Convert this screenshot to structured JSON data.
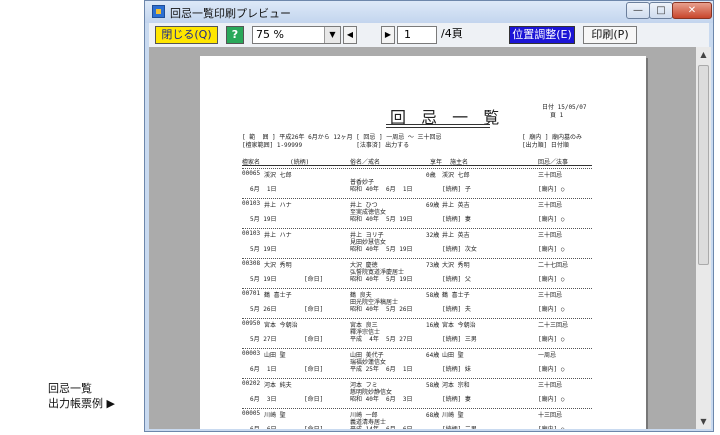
{
  "caption": {
    "line1": "回忌一覧",
    "line2": "出力帳票例 ▶"
  },
  "window": {
    "title": "回忌一覧印刷プレビュー",
    "min": "—",
    "max": "□",
    "close": "✕"
  },
  "toolbar": {
    "close_label": "閉じる(Q)",
    "help_label": "?",
    "zoom_value": "75 %",
    "dropdown_glyph": "▼",
    "prev_glyph": "◀",
    "next_glyph": "▶",
    "page_value": "1",
    "page_total": "/4頁",
    "position_label": "位置調整(E)",
    "print_label": "印刷(P)"
  },
  "scroll": {
    "up": "▲",
    "down": "▼"
  },
  "report": {
    "title": "回 忌 一 覧",
    "date_line": "日付 15/05/07",
    "page_line": "頁   1",
    "cond_left1": "[ 範  囲 ] 平成26年 6月から 12ヶ月 [ 回忌 ] 一周忌 ～ 三十回忌",
    "cond_left2": "[檀家範囲] 1-99999               [法事済] 出力する",
    "cond_right1": "[ 廟内 ] 廟内墓のみ",
    "cond_right2": "[出力順] 日付順",
    "headers": {
      "danka": "檀家名",
      "zokugara": "(続柄)",
      "zokumei": "俗名／戒名",
      "kyonen": "享年",
      "sesyu": "施主名",
      "kaiki": "回忌／法事"
    },
    "records": [
      {
        "no": "00065",
        "name": "渓沢 七郎",
        "date": "6月  1日",
        "kind": "",
        "zokumei": "",
        "kaimyo": "普香妙子",
        "era": "昭和 40年  6月  1日",
        "age": "0歳",
        "sesyu": "渓沢 七郎",
        "rel": "[続柄] 子",
        "kaiki": "三十回忌",
        "place": "[廟内] ○"
      },
      {
        "no": "00103",
        "name": "井上 ハナ",
        "date": "5月 19日",
        "kind": "",
        "zokumei": "井上 ひつ",
        "kaimyo": "至実成徳信女",
        "era": "昭和 40年  5月 19日",
        "age": "69歳",
        "sesyu": "井上 英吉",
        "rel": "[続柄] 妻",
        "kaiki": "三十回忌",
        "place": "[廟内] ○"
      },
      {
        "no": "00103",
        "name": "井上 ハナ",
        "date": "5月 19日",
        "kind": "",
        "zokumei": "井上 ヨリ子",
        "kaimyo": "見田妙慧信女",
        "era": "昭和 40年  5月 19日",
        "age": "32歳",
        "sesyu": "井上 英吉",
        "rel": "[続柄] 次女",
        "kaiki": "三十回忌",
        "place": "[廟内] ○"
      },
      {
        "no": "00308",
        "name": "大沢 秀明",
        "date": "5月 19日",
        "kind": "[命日]",
        "zokumei": "大沢 慶徳",
        "kaimyo": "弘誓院寛道淨慶居士",
        "era": "昭和 40年  5月 19日",
        "age": "73歳",
        "sesyu": "大沢 秀明",
        "rel": "[続柄] 父",
        "kaiki": "二十七回忌",
        "place": "[廟内] ○"
      },
      {
        "no": "00701",
        "name": "鶴 喜士子",
        "date": "5月 26日",
        "kind": "[命日]",
        "zokumei": "鶴 良夫",
        "kaimyo": "田光院空淨稿居士",
        "era": "昭和 40年  5月 26日",
        "age": "58歳",
        "sesyu": "鶴 喜士子",
        "rel": "[続柄] 夫",
        "kaiki": "三十回忌",
        "place": "[廟内] ○"
      },
      {
        "no": "00950",
        "name": "宮本 今朝治",
        "date": "5月 27日",
        "kind": "[命日]",
        "zokumei": "宮本 良三",
        "kaimyo": "釋淨宗信士",
        "era": "平成  4年  5月 27日",
        "age": "16歳",
        "sesyu": "宮本 今朝治",
        "rel": "[続柄] 三男",
        "kaiki": "二十三回忌",
        "place": "[廟内] ○"
      },
      {
        "no": "00003",
        "name": "山田 聖",
        "date": "6月  1日",
        "kind": "[命日]",
        "zokumei": "山田 美代子",
        "kaimyo": "瑞福妙蓮信女",
        "era": "平成 25年  6月  1日",
        "age": "64歳",
        "sesyu": "山田 聖",
        "rel": "[続柄] 妹",
        "kaiki": "一周忌",
        "place": "[廟内] ○"
      },
      {
        "no": "00202",
        "name": "河本 純夫",
        "date": "6月  3日",
        "kind": "[命日]",
        "zokumei": "河本 フミ",
        "kaimyo": "慈明院妙静信女",
        "era": "昭和 40年  6月  3日",
        "age": "58歳",
        "sesyu": "河本 宗和",
        "rel": "[続柄] 妻",
        "kaiki": "三十回忌",
        "place": "[廟内] ○"
      },
      {
        "no": "00005",
        "name": "川崎 聖",
        "date": "6月  6日",
        "kind": "[命日]",
        "zokumei": "川崎 一郎",
        "kaimyo": "義道清寿居士",
        "era": "平成 14年  6月  6日",
        "age": "68歳",
        "sesyu": "川崎 聖",
        "rel": "[続柄] 二男",
        "kaiki": "十三回忌",
        "place": "[廟内] ○"
      }
    ]
  }
}
